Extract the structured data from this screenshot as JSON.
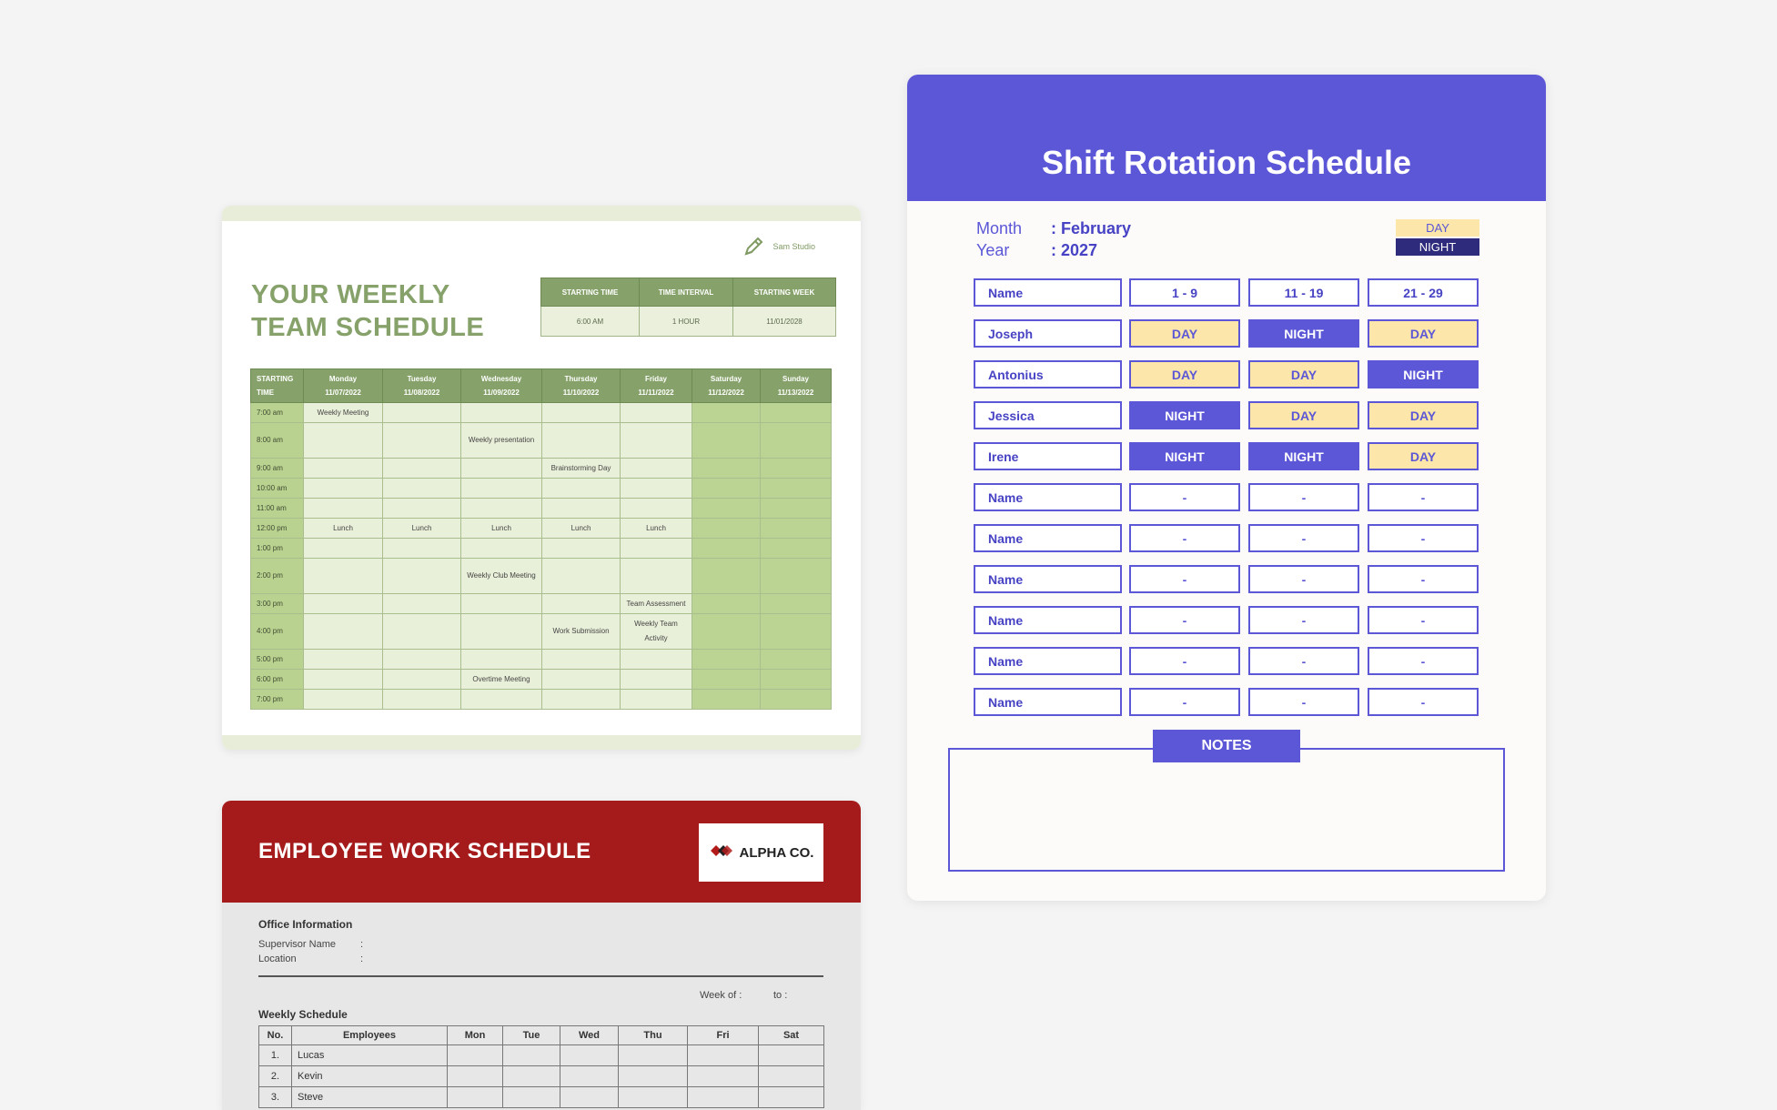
{
  "weekly": {
    "brand": "Sam Studio",
    "title_line1": "YOUR WEEKLY",
    "title_line2": "TEAM SCHEDULE",
    "info_headers": [
      "STARTING TIME",
      "TIME INTERVAL",
      "STARTING WEEK"
    ],
    "info_values": [
      "6:00 AM",
      "1 HOUR",
      "11/01/2028"
    ],
    "col_time_l1": "STARTING",
    "col_time_l2": "TIME",
    "days": [
      {
        "name": "Monday",
        "date": "11/07/2022"
      },
      {
        "name": "Tuesday",
        "date": "11/08/2022"
      },
      {
        "name": "Wednesday",
        "date": "11/09/2022"
      },
      {
        "name": "Thursday",
        "date": "11/10/2022"
      },
      {
        "name": "Friday",
        "date": "11/11/2022"
      },
      {
        "name": "Saturday",
        "date": "11/12/2022"
      },
      {
        "name": "Sunday",
        "date": "11/13/2022"
      }
    ],
    "rows": [
      {
        "time": "7:00 am",
        "cells": [
          "Weekly Meeting",
          "",
          "",
          "",
          "",
          "",
          ""
        ]
      },
      {
        "time": "8:00 am",
        "cells": [
          "",
          "",
          "Weekly presentation",
          "",
          "",
          "",
          ""
        ]
      },
      {
        "time": "9:00 am",
        "cells": [
          "",
          "",
          "",
          "Brainstorming Day",
          "",
          "",
          ""
        ]
      },
      {
        "time": "10:00 am",
        "cells": [
          "",
          "",
          "",
          "",
          "",
          "",
          ""
        ]
      },
      {
        "time": "11:00 am",
        "cells": [
          "",
          "",
          "",
          "",
          "",
          "",
          ""
        ]
      },
      {
        "time": "12:00 pm",
        "cells": [
          "Lunch",
          "Lunch",
          "Lunch",
          "Lunch",
          "Lunch",
          "",
          ""
        ]
      },
      {
        "time": "1:00 pm",
        "cells": [
          "",
          "",
          "",
          "",
          "",
          "",
          ""
        ]
      },
      {
        "time": "2:00 pm",
        "cells": [
          "",
          "",
          "Weekly Club Meeting",
          "",
          "",
          "",
          ""
        ]
      },
      {
        "time": "3:00 pm",
        "cells": [
          "",
          "",
          "",
          "",
          "Team Assessment",
          "",
          ""
        ]
      },
      {
        "time": "4:00 pm",
        "cells": [
          "",
          "",
          "",
          "Work Submission",
          "Weekly Team Activity",
          "",
          ""
        ]
      },
      {
        "time": "5:00 pm",
        "cells": [
          "",
          "",
          "",
          "",
          "",
          "",
          ""
        ]
      },
      {
        "time": "6:00 pm",
        "cells": [
          "",
          "",
          "Overtime Meeting",
          "",
          "",
          "",
          ""
        ]
      },
      {
        "time": "7:00 pm",
        "cells": [
          "",
          "",
          "",
          "",
          "",
          "",
          ""
        ]
      }
    ]
  },
  "employee": {
    "title": "EMPLOYEE WORK SCHEDULE",
    "logo_text": "ALPHA CO.",
    "office_heading": "Office Information",
    "supervisor_label": "Supervisor Name",
    "location_label": "Location",
    "colon": ":",
    "week_of_label": "Week of :",
    "to_label": "to :",
    "weekly_schedule_heading": "Weekly Schedule",
    "headers": [
      "No.",
      "Employees",
      "Mon",
      "Tue",
      "Wed",
      "Thu",
      "Fri",
      "Sat"
    ],
    "rows": [
      {
        "no": "1.",
        "name": "Lucas"
      },
      {
        "no": "2.",
        "name": "Kevin"
      },
      {
        "no": "3.",
        "name": "Steve"
      }
    ]
  },
  "shift": {
    "title": "Shift Rotation Schedule",
    "month_label": "Month",
    "month_value": ": February",
    "year_label": "Year",
    "year_value": ": 2027",
    "legend_day": "DAY",
    "legend_night": "NIGHT",
    "header_row": [
      "Name",
      "1 - 9",
      "11 - 19",
      "21 - 29"
    ],
    "rows": [
      {
        "name": "Joseph",
        "shifts": [
          "DAY",
          "NIGHT",
          "DAY"
        ]
      },
      {
        "name": "Antonius",
        "shifts": [
          "DAY",
          "DAY",
          "NIGHT"
        ]
      },
      {
        "name": "Jessica",
        "shifts": [
          "NIGHT",
          "DAY",
          "DAY"
        ]
      },
      {
        "name": "Irene",
        "shifts": [
          "NIGHT",
          "NIGHT",
          "DAY"
        ]
      },
      {
        "name": "Name",
        "shifts": [
          "-",
          "-",
          "-"
        ]
      },
      {
        "name": "Name",
        "shifts": [
          "-",
          "-",
          "-"
        ]
      },
      {
        "name": "Name",
        "shifts": [
          "-",
          "-",
          "-"
        ]
      },
      {
        "name": "Name",
        "shifts": [
          "-",
          "-",
          "-"
        ]
      },
      {
        "name": "Name",
        "shifts": [
          "-",
          "-",
          "-"
        ]
      },
      {
        "name": "Name",
        "shifts": [
          "-",
          "-",
          "-"
        ]
      }
    ],
    "notes_label": "NOTES",
    "colors": {
      "primary": "#5b57d6",
      "day": "#fde6a9",
      "night_legend": "#2e2b7c"
    }
  }
}
